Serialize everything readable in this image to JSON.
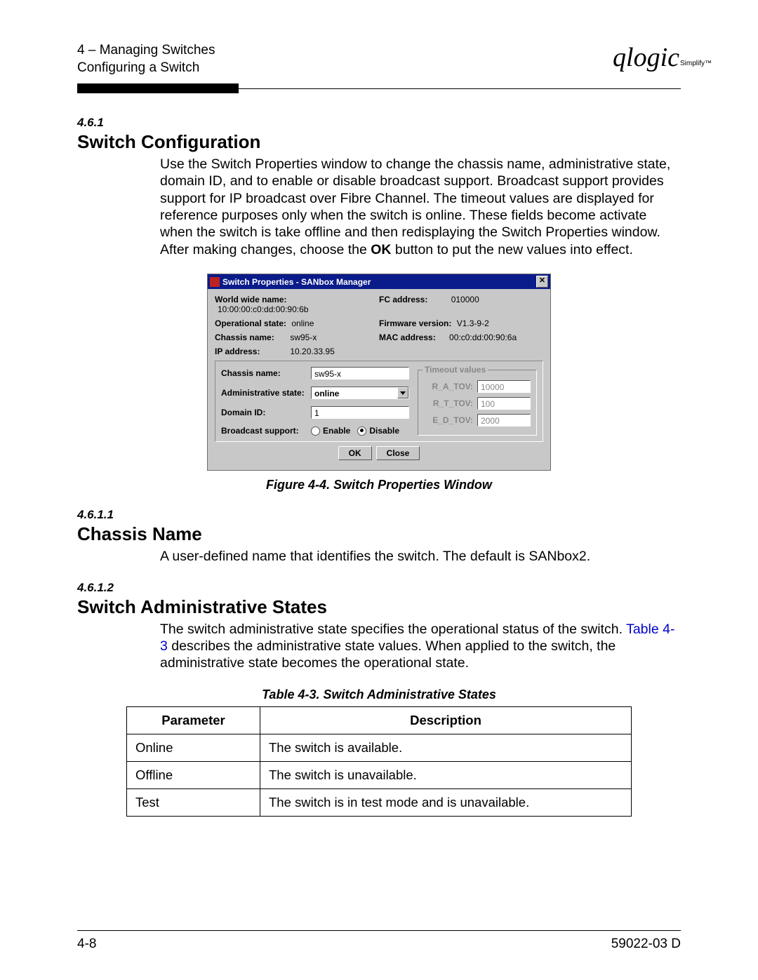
{
  "header": {
    "line1": "4 – Managing Switches",
    "line2": "Configuring a Switch",
    "logo_main": "qlogic",
    "logo_sub": "Simplify™"
  },
  "sec": {
    "num": "4.6.1",
    "title": "Switch Configuration",
    "para_a": "Use the Switch Properties window to change the chassis name, administrative state, domain ID, and to enable or disable broadcast support. Broadcast support provides support for IP broadcast over Fibre Channel. The timeout values are displayed for reference purposes only when the switch is online. These fields become activate when the switch is take offline and then redisplaying the Switch Properties window. After making changes, choose the ",
    "para_bold": "OK",
    "para_b": " button to put the new values into effect."
  },
  "dialog": {
    "title": "Switch Properties - SANbox Manager",
    "wwn_label": "World wide name:",
    "wwn_value": "10:00:00:c0:dd:00:90:6b",
    "opstate_label": "Operational state:",
    "opstate_value": "online",
    "chassis_label": "Chassis name:",
    "chassis_value": "sw95-x",
    "ip_label": "IP address:",
    "ip_value": "10.20.33.95",
    "fc_label": "FC address:",
    "fc_value": "010000",
    "fw_label": "Firmware version:",
    "fw_value": "V1.3-9-2",
    "mac_label": "MAC address:",
    "mac_value": "00:c0:dd:00:90:6a",
    "form": {
      "chassis_label": "Chassis name:",
      "chassis_value": "sw95-x",
      "admin_label": "Administrative state:",
      "admin_value": "online",
      "domain_label": "Domain ID:",
      "domain_value": "1",
      "bcast_label": "Broadcast support:",
      "enable": "Enable",
      "disable": "Disable"
    },
    "timeout": {
      "legend": "Timeout values",
      "ra_label": "R_A_TOV:",
      "ra_value": "10000",
      "rt_label": "R_T_TOV:",
      "rt_value": "100",
      "ed_label": "E_D_TOV:",
      "ed_value": "2000"
    },
    "ok": "OK",
    "close": "Close"
  },
  "fig_caption": "Figure 4-4.  Switch Properties Window",
  "sub1": {
    "num": "4.6.1.1",
    "title": "Chassis Name",
    "text": "A user-defined name that identifies the switch. The default is SANbox2."
  },
  "sub2": {
    "num": "4.6.1.2",
    "title": "Switch Administrative States",
    "text_a": "The switch administrative state specifies the operational status of the switch. ",
    "link": "Table 4-3",
    "text_b": " describes the administrative state values. When applied to the switch, the administrative state becomes the operational state."
  },
  "table": {
    "caption": "Table 4-3. Switch Administrative States",
    "h1": "Parameter",
    "h2": "Description",
    "rows": [
      {
        "p": "Online",
        "d": "The switch is available."
      },
      {
        "p": "Offline",
        "d": "The switch is unavailable."
      },
      {
        "p": "Test",
        "d": "The switch is in test mode and is unavailable."
      }
    ]
  },
  "footer": {
    "left": "4-8",
    "right": "59022-03  D"
  }
}
